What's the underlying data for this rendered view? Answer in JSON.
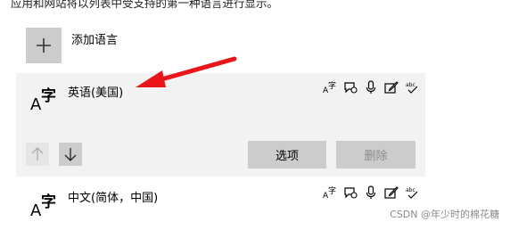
{
  "intro_text": "应用和网站将以列表中受支持的第一种语言进行显示。",
  "add_language": {
    "label": "添加语言",
    "icon": "plus-icon"
  },
  "languages": [
    {
      "name": "英语(美国)",
      "glyph_a": "A",
      "glyph_z": "字",
      "features": [
        "display-language-icon",
        "speech-icon",
        "microphone-icon",
        "handwriting-icon",
        "spellcheck-icon"
      ],
      "selected": true,
      "move_up_icon": "arrow-up-icon",
      "move_down_icon": "arrow-down-icon",
      "options_label": "选项",
      "remove_label": "删除"
    },
    {
      "name": "中文(简体，中国)",
      "glyph_a": "A",
      "glyph_z": "字",
      "features": [
        "display-language-icon",
        "speech-icon",
        "microphone-icon",
        "handwriting-icon",
        "spellcheck-icon"
      ],
      "selected": false
    }
  ],
  "watermark": "CSDN @年少时的棉花糖",
  "colors": {
    "arrow": "#e8161b",
    "selected_bg": "#f2f2f2",
    "button_bg": "#cccccc"
  }
}
